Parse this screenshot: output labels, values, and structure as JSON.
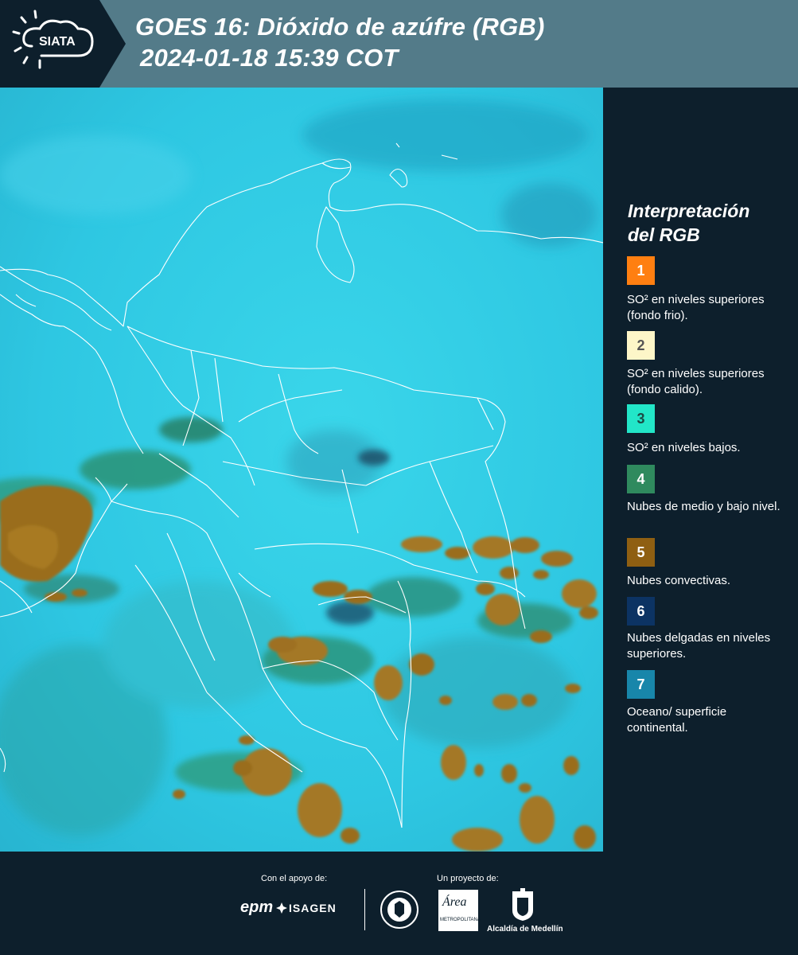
{
  "header": {
    "logo_text": "SIATA",
    "title_line1": "GOES 16: Dióxido de azúfre (RGB)",
    "title_line2": "2024-01-18 15:39 COT"
  },
  "legend": {
    "title_line1": "Interpretación",
    "title_line2": "del RGB",
    "items": [
      {
        "number": "1",
        "color": "#ff7f11",
        "text_color": "#ffffff",
        "label": "SO² en niveles superiores (fondo frio)."
      },
      {
        "number": "2",
        "color": "#fdf6c8",
        "text_color": "#555555",
        "label": "SO² en niveles superiores (fondo calido)."
      },
      {
        "number": "3",
        "color": "#22e6c8",
        "text_color": "#1c4a45",
        "label": "SO² en niveles bajos."
      },
      {
        "number": "4",
        "color": "#2f8a5e",
        "text_color": "#ffffff",
        "label": "Nubes de medio y bajo nivel."
      },
      {
        "number": "5",
        "color": "#8f5f12",
        "text_color": "#ffffff",
        "label": "Nubes convectivas."
      },
      {
        "number": "6",
        "color": "#0c3363",
        "text_color": "#ffffff",
        "label": "Nubes delgadas en niveles superiores."
      },
      {
        "number": "7",
        "color": "#1886aa",
        "text_color": "#ffffff",
        "label": "Oceano/ superficie continental."
      }
    ]
  },
  "footer": {
    "support_label": "Con el apoyo de:",
    "project_label": "Un proyecto de:",
    "sponsor_1": "epm",
    "sponsor_2": "ISAGEN",
    "partner_1_text": "Área",
    "partner_1_sub": "METROPOLITANA",
    "partner_2": "Alcaldía de Medellín"
  }
}
